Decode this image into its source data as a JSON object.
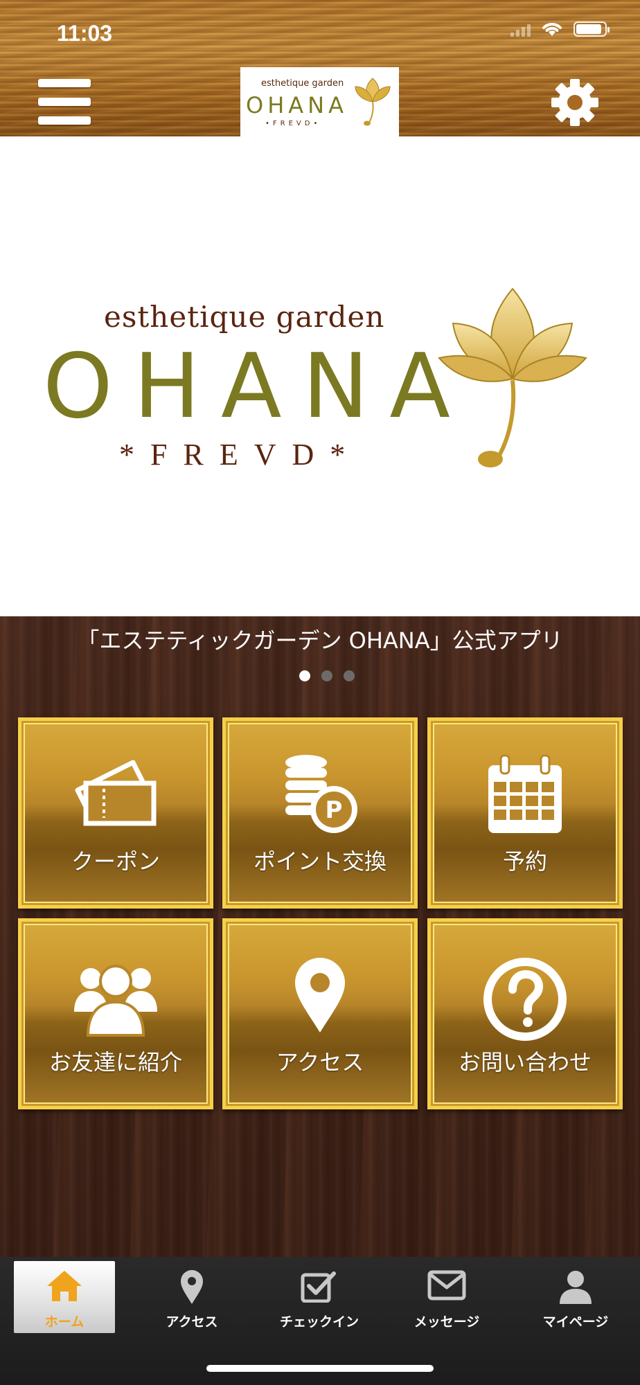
{
  "status_bar": {
    "time": "11:03"
  },
  "header": {
    "menu_icon": "hamburger-menu-icon",
    "settings_icon": "gear-icon",
    "logo": {
      "top": "esthetique garden",
      "main": "OHANA",
      "sub": "•FREVD•"
    }
  },
  "hero": {
    "top": "esthetique garden",
    "main": "OHANA",
    "sub": "*FREVD*"
  },
  "carousel": {
    "caption": "「エステティックガーデン OHANA」公式アプリ",
    "pages": 3,
    "active_page": 1
  },
  "tiles": [
    {
      "label": "クーポン",
      "icon": "coupon-ticket-icon"
    },
    {
      "label": "ポイント交換",
      "icon": "point-coins-icon"
    },
    {
      "label": "予約",
      "icon": "calendar-icon"
    },
    {
      "label": "お友達に紹介",
      "icon": "friends-group-icon"
    },
    {
      "label": "アクセス",
      "icon": "map-pin-icon"
    },
    {
      "label": "お問い合わせ",
      "icon": "question-icon"
    }
  ],
  "tabbar": {
    "items": [
      {
        "label": "ホーム",
        "icon": "home-icon",
        "active": true
      },
      {
        "label": "アクセス",
        "icon": "map-pin-icon",
        "active": false
      },
      {
        "label": "チェックイン",
        "icon": "checkin-icon",
        "active": false
      },
      {
        "label": "メッセージ",
        "icon": "mail-icon",
        "active": false
      },
      {
        "label": "マイページ",
        "icon": "user-icon",
        "active": false
      }
    ]
  },
  "colors": {
    "gold_border": "#f7d04a",
    "brand_olive": "#7b7a22",
    "brand_brown": "#5a2410",
    "active_tab": "#f0a31c"
  }
}
